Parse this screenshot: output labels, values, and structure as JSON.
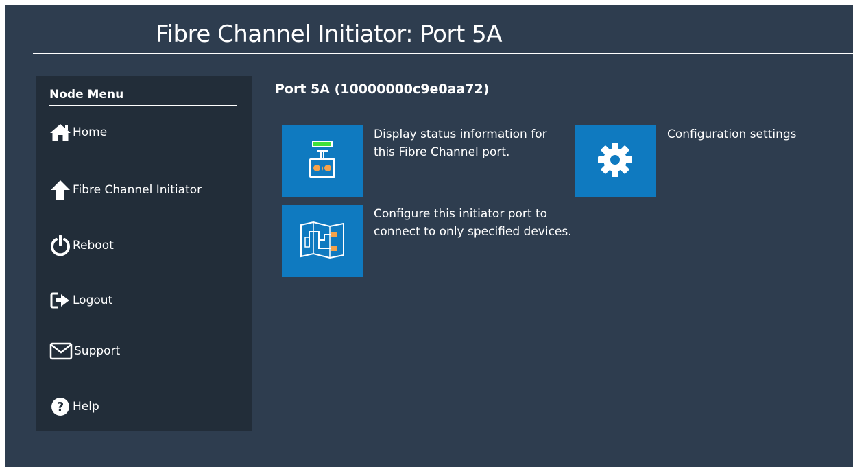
{
  "header": {
    "title": "Fibre Channel Initiator: Port 5A"
  },
  "sidebar": {
    "heading": "Node Menu",
    "items": [
      {
        "label": "Home",
        "icon": "home-icon"
      },
      {
        "label": "Fibre Channel Initiator",
        "icon": "arrow-up-icon"
      },
      {
        "label": "Reboot",
        "icon": "power-icon"
      },
      {
        "label": "Logout",
        "icon": "logout-icon"
      },
      {
        "label": "Support",
        "icon": "envelope-icon"
      },
      {
        "label": "Help",
        "icon": "question-icon"
      }
    ]
  },
  "main": {
    "section_title": "Port 5A (10000000c9e0aa72)",
    "actions": [
      {
        "text": "Display status information for this Fibre Channel port.",
        "icon": "port-status-icon"
      },
      {
        "text": "Configuration settings",
        "icon": "gear-icon"
      },
      {
        "text": "Configure this initiator port to connect to only specified devices.",
        "icon": "device-map-icon"
      }
    ]
  },
  "colors": {
    "background": "#2e3d4f",
    "sidebar": "#222d39",
    "tile": "#0f7ac0",
    "text": "#ffffff"
  }
}
